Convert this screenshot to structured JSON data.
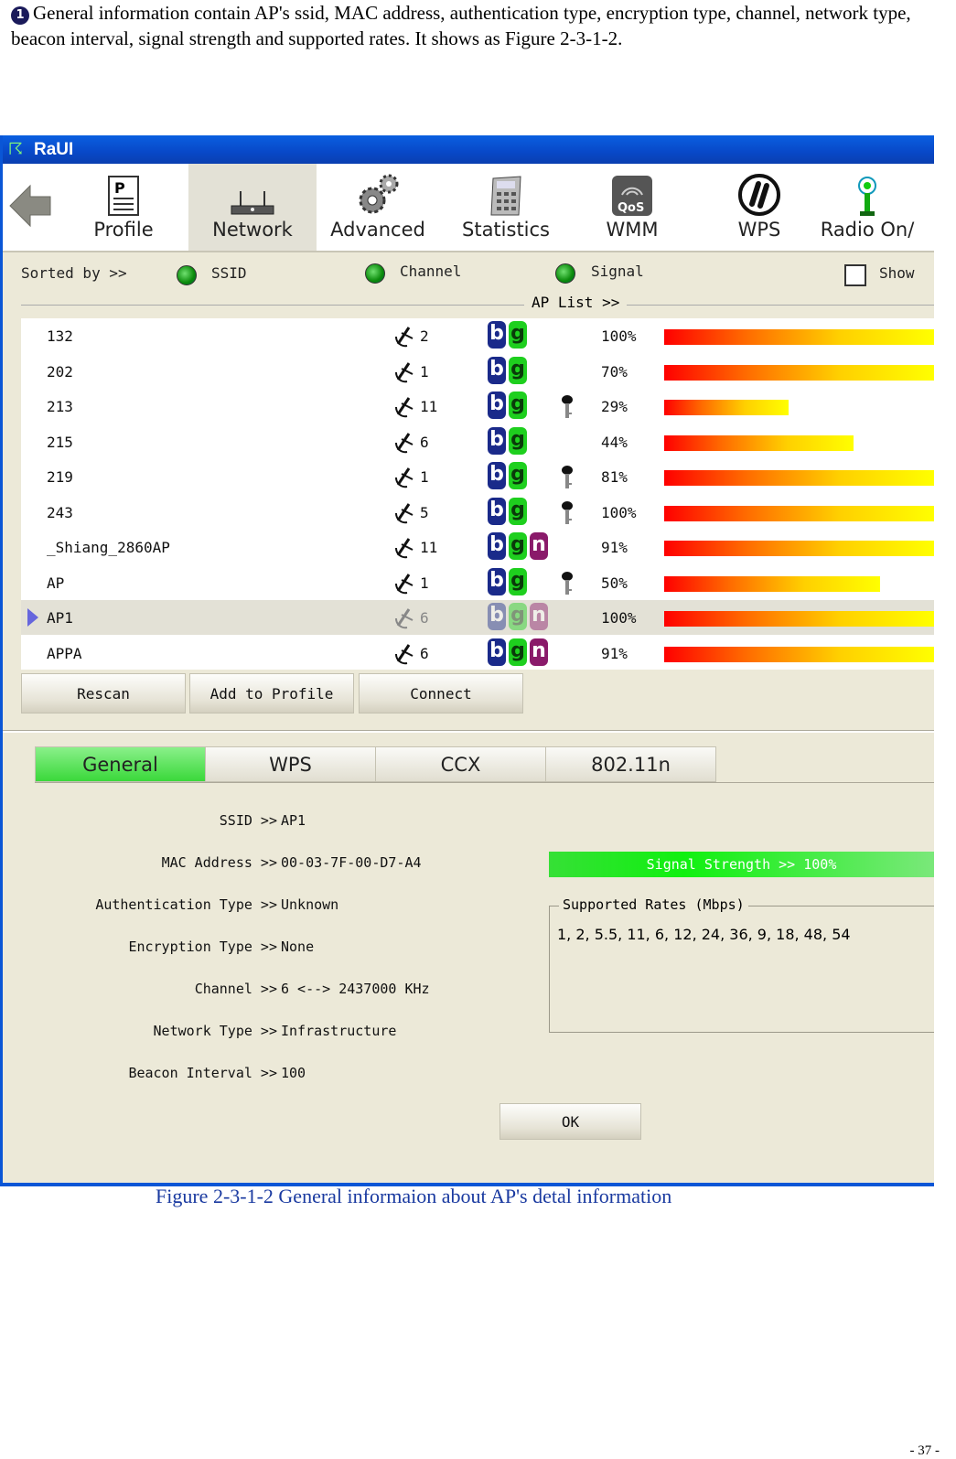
{
  "doc": {
    "bullet": "1",
    "intro": "General information contain AP's ssid, MAC address, authentication type, encryption type, channel, network type, beacon interval, signal strength and supported rates. It shows as Figure 2-3-1-2.",
    "caption": "Figure 2-3-1-2 General informaion about AP's detal information",
    "page_number": "- 37 -"
  },
  "window": {
    "title": "RaUI"
  },
  "toolbar": {
    "items": [
      {
        "label": "Profile",
        "icon": "profile-icon"
      },
      {
        "label": "Network",
        "icon": "network-icon",
        "active": true
      },
      {
        "label": "Advanced",
        "icon": "gears-icon"
      },
      {
        "label": "Statistics",
        "icon": "calculator-icon"
      },
      {
        "label": "WMM",
        "icon": "qos-icon"
      },
      {
        "label": "WPS",
        "icon": "wps-icon"
      },
      {
        "label": "Radio On/",
        "icon": "radio-antenna-icon"
      }
    ]
  },
  "sort": {
    "label": "Sorted by >>",
    "ssid": "SSID",
    "channel": "Channel",
    "signal": "Signal",
    "show": "Show"
  },
  "ap_list": {
    "title": "AP List >>",
    "rows": [
      {
        "ssid": "132",
        "channel": "2",
        "modes": [
          "b",
          "g"
        ],
        "key": false,
        "signal": "100%",
        "level": 100
      },
      {
        "ssid": "202",
        "channel": "1",
        "modes": [
          "b",
          "g"
        ],
        "key": false,
        "signal": "70%",
        "level": 100
      },
      {
        "ssid": "213",
        "channel": "11",
        "modes": [
          "b",
          "g"
        ],
        "key": true,
        "signal": "29%",
        "level": 46
      },
      {
        "ssid": "215",
        "channel": "6",
        "modes": [
          "b",
          "g"
        ],
        "key": false,
        "signal": "44%",
        "level": 70
      },
      {
        "ssid": "219",
        "channel": "1",
        "modes": [
          "b",
          "g"
        ],
        "key": true,
        "signal": "81%",
        "level": 100
      },
      {
        "ssid": "243",
        "channel": "5",
        "modes": [
          "b",
          "g"
        ],
        "key": true,
        "signal": "100%",
        "level": 100
      },
      {
        "ssid": "_Shiang_2860AP",
        "channel": "11",
        "modes": [
          "b",
          "g",
          "n"
        ],
        "key": false,
        "signal": "91%",
        "level": 100
      },
      {
        "ssid": "AP",
        "channel": "1",
        "modes": [
          "b",
          "g"
        ],
        "key": true,
        "signal": "50%",
        "level": 80
      },
      {
        "ssid": "AP1",
        "channel": "6",
        "modes": [
          "b",
          "g",
          "n"
        ],
        "key": false,
        "signal": "100%",
        "level": 100,
        "selected": true
      },
      {
        "ssid": "APPA",
        "channel": "6",
        "modes": [
          "b",
          "g",
          "n"
        ],
        "key": false,
        "signal": "91%",
        "level": 100
      }
    ]
  },
  "actions": {
    "rescan": "Rescan",
    "add_to_profile": "Add to Profile",
    "connect": "Connect"
  },
  "tabs": [
    "General",
    "WPS",
    "CCX",
    "802.11n"
  ],
  "general": {
    "ssid_label": "SSID >>",
    "ssid": "AP1",
    "mac_label": "MAC Address >>",
    "mac": "00-03-7F-00-D7-A4",
    "auth_label": "Authentication Type >>",
    "auth": "Unknown",
    "enc_label": "Encryption Type >>",
    "enc": "None",
    "channel_label": "Channel >>",
    "channel": "6 <--> 2437000 KHz",
    "nettype_label": "Network Type >>",
    "nettype": "Infrastructure",
    "beacon_label": "Beacon Interval >>",
    "beacon": "100",
    "signal_strength": "Signal Strength >> 100%",
    "rates_title": "Supported Rates (Mbps)",
    "rates": "1, 2, 5.5, 11, 6, 12, 24, 36, 9, 18, 48, 54",
    "ok": "OK"
  }
}
